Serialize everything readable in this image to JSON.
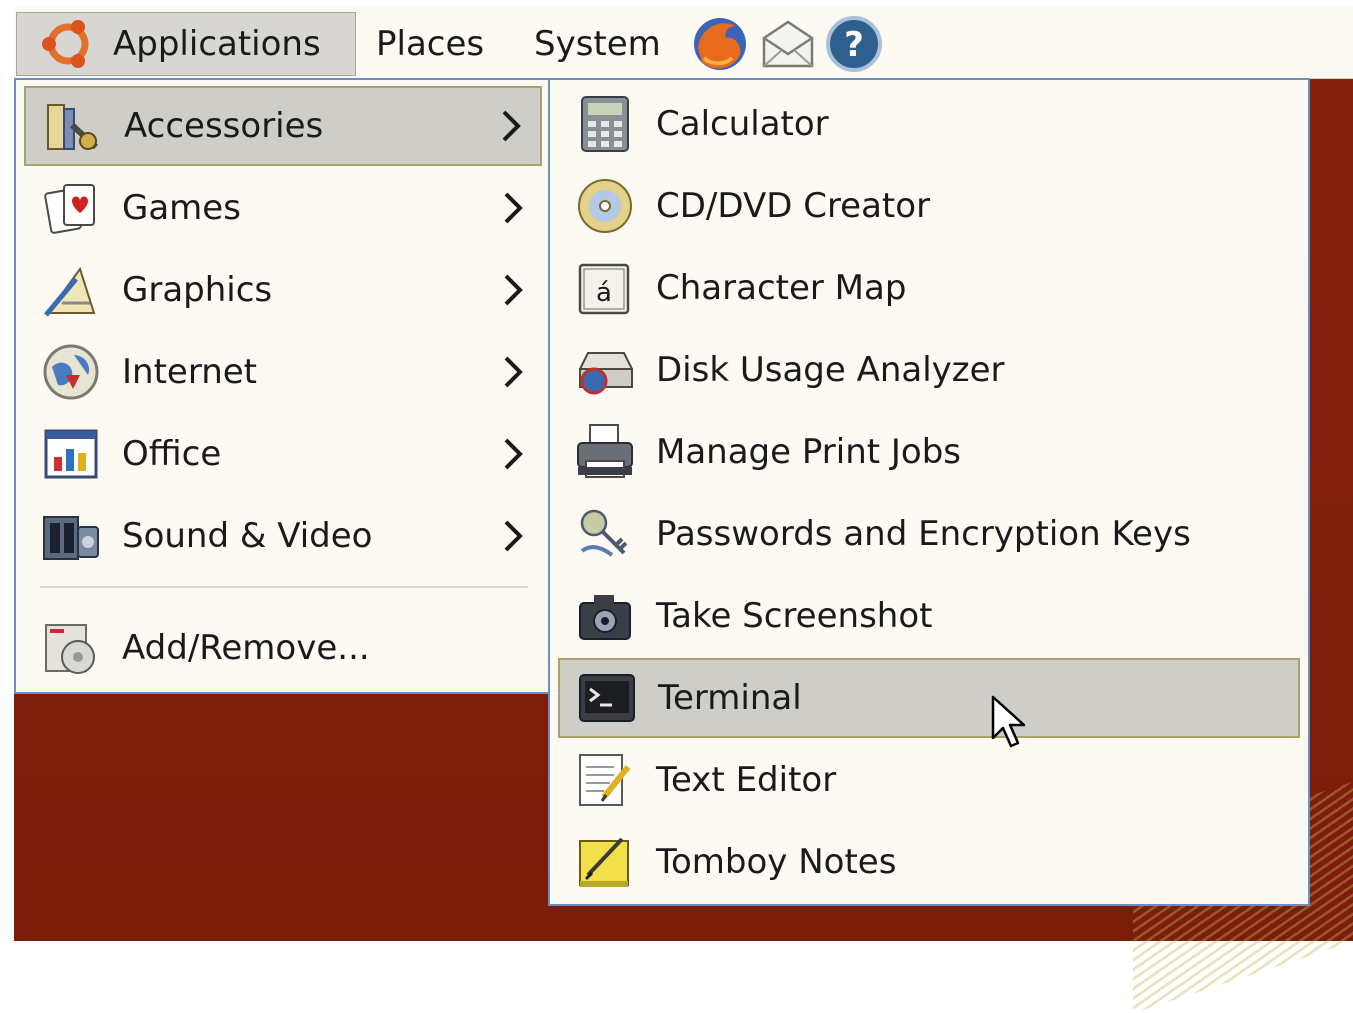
{
  "panel": {
    "applications_label": "Applications",
    "places_label": "Places",
    "system_label": "System",
    "launchers": [
      {
        "icon": "firefox-icon"
      },
      {
        "icon": "mail-icon"
      },
      {
        "icon": "help-icon"
      }
    ]
  },
  "main_menu": {
    "items": [
      {
        "label": "Accessories",
        "icon": "accessories-icon",
        "selected": true
      },
      {
        "label": "Games",
        "icon": "games-icon"
      },
      {
        "label": "Graphics",
        "icon": "graphics-icon"
      },
      {
        "label": "Internet",
        "icon": "internet-icon"
      },
      {
        "label": "Office",
        "icon": "office-icon"
      },
      {
        "label": "Sound & Video",
        "icon": "sound-video-icon"
      }
    ],
    "add_remove_label": "Add/Remove..."
  },
  "submenu": {
    "items": [
      {
        "label": "Calculator",
        "icon": "calculator-icon"
      },
      {
        "label": "CD/DVD Creator",
        "icon": "cd-dvd-icon"
      },
      {
        "label": "Character Map",
        "icon": "character-map-icon"
      },
      {
        "label": "Disk Usage Analyzer",
        "icon": "disk-usage-icon"
      },
      {
        "label": "Manage Print Jobs",
        "icon": "printer-icon"
      },
      {
        "label": "Passwords and Encryption Keys",
        "icon": "keys-icon"
      },
      {
        "label": "Take Screenshot",
        "icon": "camera-icon"
      },
      {
        "label": "Terminal",
        "icon": "terminal-icon",
        "selected": true
      },
      {
        "label": "Text Editor",
        "icon": "text-editor-icon"
      },
      {
        "label": "Tomboy Notes",
        "icon": "tomboy-notes-icon"
      }
    ]
  },
  "colors": {
    "desktop": "#86200e",
    "menu_bg": "#fcfaf2",
    "menu_border": "#6b8fbd",
    "selected_bg": "#cfcdc7"
  }
}
